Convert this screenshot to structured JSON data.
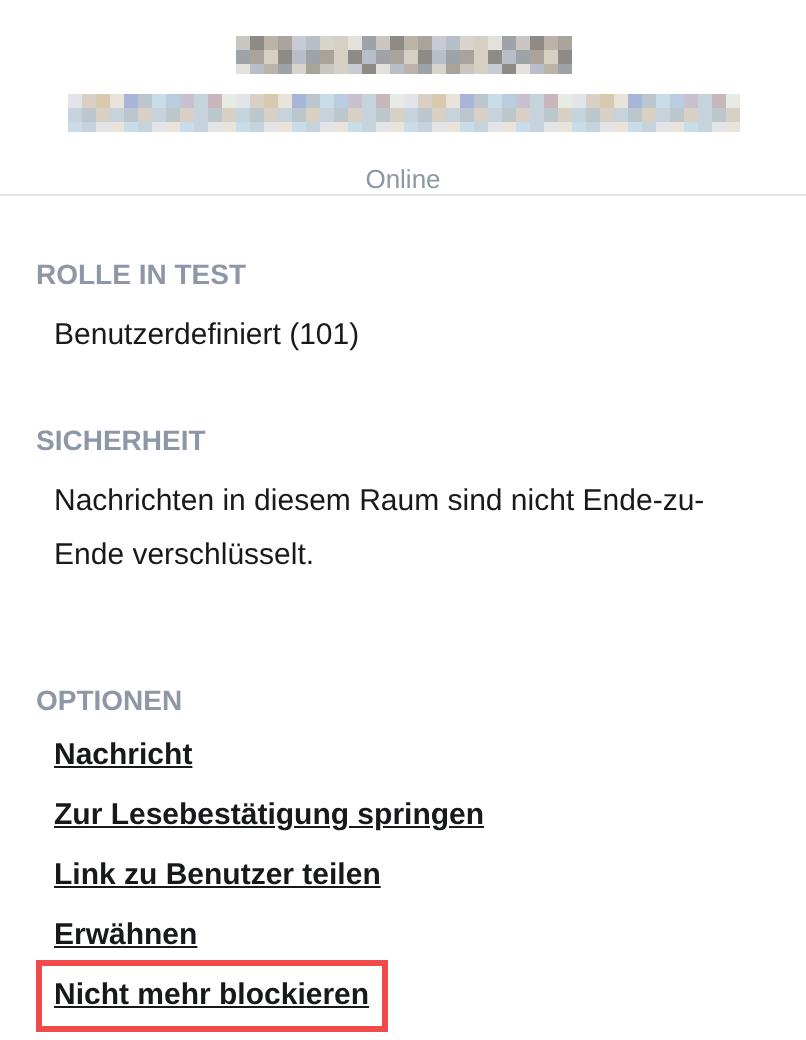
{
  "header": {
    "status": "Online"
  },
  "sections": [
    {
      "heading": "ROLLE IN TEST",
      "text": "Benutzerdefiniert (101)"
    },
    {
      "heading": "SICHERHEIT",
      "text": "Nachrichten in diesem Raum sind nicht Ende-zu-Ende verschlüsselt."
    }
  ],
  "options": {
    "heading": "OPTIONEN",
    "items": [
      {
        "label": "Nachricht",
        "highlighted": false
      },
      {
        "label": "Zur Lesebestätigung springen",
        "highlighted": false
      },
      {
        "label": "Link zu Benutzer teilen",
        "highlighted": false
      },
      {
        "label": "Erwähnen",
        "highlighted": false
      },
      {
        "label": "Nicht mehr blockieren",
        "highlighted": true
      }
    ]
  }
}
